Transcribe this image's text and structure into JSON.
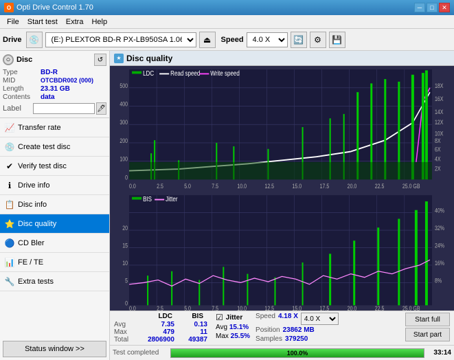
{
  "app": {
    "title": "Opti Drive Control 1.70",
    "icon": "O"
  },
  "title_buttons": {
    "minimize": "─",
    "maximize": "□",
    "close": "✕"
  },
  "menu": {
    "items": [
      "File",
      "Start test",
      "Extra",
      "Help"
    ]
  },
  "toolbar": {
    "drive_label": "Drive",
    "drive_value": "(E:)  PLEXTOR BD-R  PX-LB950SA 1.06",
    "speed_label": "Speed",
    "speed_value": "4.0 X"
  },
  "disc": {
    "header": "Disc",
    "type_label": "Type",
    "type_value": "BD-R",
    "mid_label": "MID",
    "mid_value": "OTCBDR002 (000)",
    "length_label": "Length",
    "length_value": "23.31 GB",
    "contents_label": "Contents",
    "contents_value": "data",
    "label_label": "Label",
    "label_value": ""
  },
  "nav": {
    "items": [
      {
        "id": "transfer-rate",
        "label": "Transfer rate",
        "icon": "📈"
      },
      {
        "id": "create-test-disc",
        "label": "Create test disc",
        "icon": "💿"
      },
      {
        "id": "verify-test-disc",
        "label": "Verify test disc",
        "icon": "✔"
      },
      {
        "id": "drive-info",
        "label": "Drive info",
        "icon": "ℹ"
      },
      {
        "id": "disc-info",
        "label": "Disc info",
        "icon": "📋"
      },
      {
        "id": "disc-quality",
        "label": "Disc quality",
        "icon": "⭐",
        "active": true
      },
      {
        "id": "cd-bler",
        "label": "CD Bler",
        "icon": "🔵"
      },
      {
        "id": "fe-te",
        "label": "FE / TE",
        "icon": "📊"
      },
      {
        "id": "extra-tests",
        "label": "Extra tests",
        "icon": "🔧"
      }
    ],
    "status_btn": "Status window >>"
  },
  "panel": {
    "title": "Disc quality",
    "icon": "★"
  },
  "chart1": {
    "legend": [
      {
        "label": "LDC",
        "color": "#00aa00"
      },
      {
        "label": "Read speed",
        "color": "#ffffff"
      },
      {
        "label": "Write speed",
        "color": "#ff00ff"
      }
    ],
    "y_max": 500,
    "y_right_labels": [
      "18X",
      "16X",
      "14X",
      "12X",
      "10X",
      "8X",
      "6X",
      "4X",
      "2X"
    ],
    "x_labels": [
      "0.0",
      "2.5",
      "5.0",
      "7.5",
      "10.0",
      "12.5",
      "15.0",
      "17.5",
      "20.0",
      "22.5",
      "25.0 GB"
    ]
  },
  "chart2": {
    "legend": [
      {
        "label": "BIS",
        "color": "#00aa00"
      },
      {
        "label": "Jitter",
        "color": "#ff88ff"
      }
    ],
    "y_max": 20,
    "y_right_labels": [
      "40%",
      "32%",
      "24%",
      "16%",
      "8%"
    ],
    "x_labels": [
      "0.0",
      "2.5",
      "5.0",
      "7.5",
      "10.0",
      "12.5",
      "15.0",
      "17.5",
      "20.0",
      "22.5",
      "25.0 GB"
    ]
  },
  "stats": {
    "col_headers": [
      "LDC",
      "BIS"
    ],
    "rows": [
      {
        "label": "Avg",
        "ldc": "7.35",
        "bis": "0.13"
      },
      {
        "label": "Max",
        "ldc": "479",
        "bis": "11"
      },
      {
        "label": "Total",
        "ldc": "2806900",
        "bis": "49387"
      }
    ],
    "jitter_checkbox": true,
    "jitter_label": "Jitter",
    "jitter_avg": "15.1%",
    "jitter_max": "25.5%",
    "speed_label": "Speed",
    "speed_val": "4.18 X",
    "speed_select": "4.0 X",
    "position_label": "Position",
    "position_val": "23862 MB",
    "samples_label": "Samples",
    "samples_val": "379250",
    "btn_full": "Start full",
    "btn_part": "Start part"
  },
  "progress": {
    "status": "Test completed",
    "percent": 100,
    "time": "33:14"
  }
}
